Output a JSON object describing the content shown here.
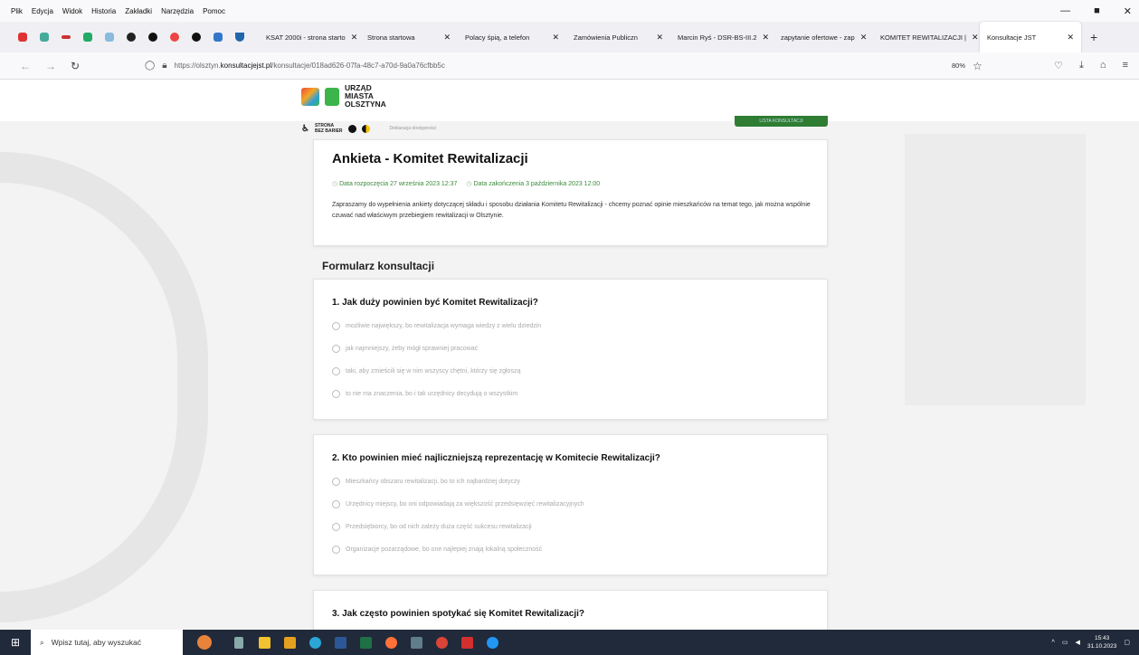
{
  "menu": [
    "Plik",
    "Edycja",
    "Widok",
    "Historia",
    "Zakładki",
    "Narzędzia",
    "Pomoc"
  ],
  "tabs": [
    {
      "label": "KSAT 2000i - strona starto",
      "active": false
    },
    {
      "label": "Strona startowa",
      "active": false
    },
    {
      "label": "Polacy śpią, a telefon",
      "active": false
    },
    {
      "label": "Zamówienia Publiczn",
      "active": false
    },
    {
      "label": "Marcin Ryś - DSR-BS-III.2",
      "active": false
    },
    {
      "label": "zapytanie ofertowe - zap",
      "active": false
    },
    {
      "label": "KOMITET REWITALIZACJI |",
      "active": false
    },
    {
      "label": "Konsultacje JST",
      "active": true
    }
  ],
  "address": {
    "prefix": "https://olsztyn.",
    "host": "konsultacjejst.pl",
    "path": "/konsultacje/018ad626-07fa-48c7-a70d-9a0a76cfbb5c",
    "zoom": "80%"
  },
  "site": {
    "logo_lines": [
      "URZĄD",
      "MIASTA",
      "OLSZTYNA"
    ],
    "a11y_label_1": "STRONA",
    "a11y_label_2": "BEZ BARIER",
    "a11y_link": "Deklaracja dostępności",
    "list_button": "LISTA KONSULTACJI"
  },
  "survey": {
    "title": "Ankieta - Komitet Rewitalizacji",
    "start": "Data rozpoczęcia 27 września 2023 12:37",
    "end": "Data zakończenia 3 października 2023 12:00",
    "description": "Zapraszamy do wypełnienia ankiety dotyczącej składu i sposobu działania Komitetu Rewitalizacji - chcemy poznać opinie mieszkańców na temat tego, jak można wspólnie czuwać nad właściwym przebiegiem rewitalizacji w Olsztynie.",
    "form_title": "Formularz konsultacji"
  },
  "questions": [
    {
      "title": "1. Jak duży powinien być Komitet Rewitalizacji?",
      "options": [
        "możliwie największy, bo rewitalizacja wymaga wiedzy z wielu dziedzin",
        "jak najmniejszy, żeby mógł sprawniej pracować",
        "taki, aby zmieścili się w nim wszyscy chętni, którzy się zgłoszą",
        "to nie ma znaczenia, bo i tak urzędnicy decydują o wszystkim"
      ]
    },
    {
      "title": "2. Kto powinien mieć najliczniejszą reprezentację w Komitecie Rewitalizacji?",
      "options": [
        "Mieszkańcy obszaru rewitalizacji, bo to ich najbardziej dotyczy",
        "Urzędnicy miejscy, bo oni odpowiadają za większość przedsięwzięć rewitalizacyjnych",
        "Przedsiębiorcy, bo od nich zależy duża część sukcesu rewitalizacji",
        "Organizacje pozarządowe, bo one najlepiej znają lokalną społeczność"
      ]
    },
    {
      "title": "3. Jak często powinien spotykać się Komitet Rewitalizacji?",
      "options": []
    }
  ],
  "taskbar": {
    "search_placeholder": "Wpisz tutaj, aby wyszukać",
    "time": "15:43",
    "date": "31.10.2023"
  }
}
